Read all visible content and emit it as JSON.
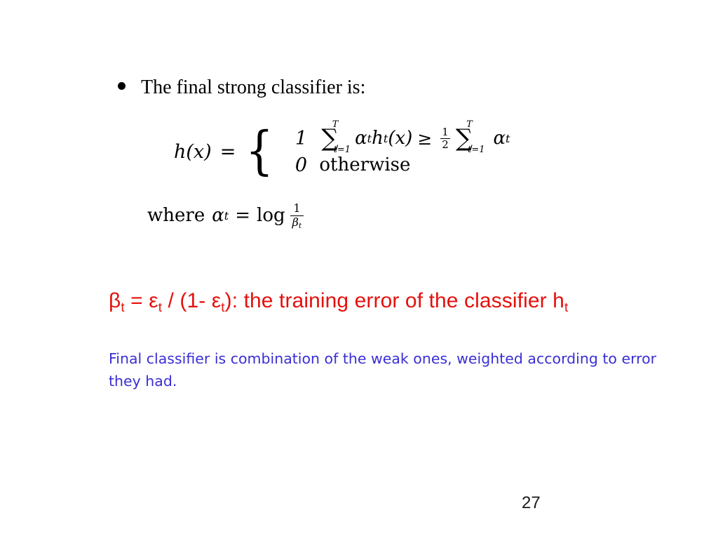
{
  "slide": {
    "background_color": "#ffffff",
    "page_number": "27",
    "bullet": {
      "marker": "bullet-dot",
      "text": "The final strong classifier is:"
    },
    "formula": {
      "lhs": "h(x)",
      "equals": "=",
      "brace": "{",
      "cases": [
        {
          "value": "1",
          "condition_text": "Σ t=1..T αₜ hₜ(x) ≥ ½ Σ t=1..T αₜ",
          "sum1": {
            "glyph": "∑",
            "upper": "T",
            "lower": "t=1"
          },
          "term1_alpha": "α",
          "term1_alpha_sub": "t",
          "term1_h": "h",
          "term1_h_sub": "t",
          "term1_arg": "(x)",
          "relation": "≥",
          "fraction": {
            "numerator": "1",
            "denominator": "2"
          },
          "sum2": {
            "glyph": "∑",
            "upper": "T",
            "lower": "t=1"
          },
          "term2_alpha": "α",
          "term2_alpha_sub": "t"
        },
        {
          "value": "0",
          "condition_text": "otherwise"
        }
      ]
    },
    "where_clause": {
      "word": "where",
      "alpha": "α",
      "alpha_sub": "t",
      "equals": "=",
      "log": "log",
      "fraction": {
        "numerator": "1",
        "denominator": "β",
        "denominator_sub": "t"
      }
    },
    "red_note": {
      "color": "#e4110d",
      "segments": [
        {
          "text": "β",
          "sub": "t"
        },
        {
          "text": " = ",
          "sub": ""
        },
        {
          "text": "ε",
          "sub": "t"
        },
        {
          "text": " / (1- ",
          "sub": ""
        },
        {
          "text": "ε",
          "sub": "t"
        },
        {
          "text": "): the training error of the classifier h",
          "sub": "t"
        }
      ],
      "plain_text": "βt = εt / (1- εt): the training error of the classifier ht"
    },
    "blue_note": {
      "color": "#3a2fd4",
      "text": "Final classifier is combination of the weak ones, weighted according to error they had."
    }
  }
}
